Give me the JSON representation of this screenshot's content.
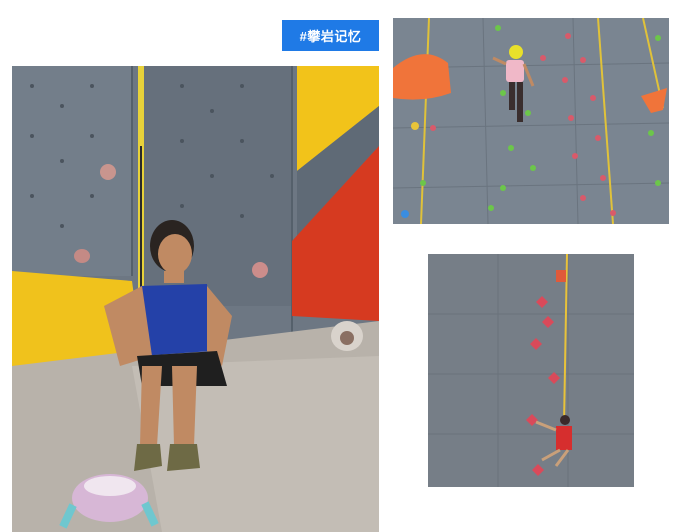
{
  "tag": {
    "label": "#攀岩记忆"
  },
  "colors": {
    "tag_bg": "#1f7ae6",
    "wall_gray": "#6b7581",
    "wall_yellow": "#f2c31a",
    "wall_red": "#d63a20",
    "rope_yellow": "#e8d23a",
    "floor": "#b9b3ab"
  },
  "photos": [
    {
      "name": "photo-girl-sitting-under-wall"
    },
    {
      "name": "photo-child-climbing-wall"
    },
    {
      "name": "photo-speed-climber"
    }
  ]
}
